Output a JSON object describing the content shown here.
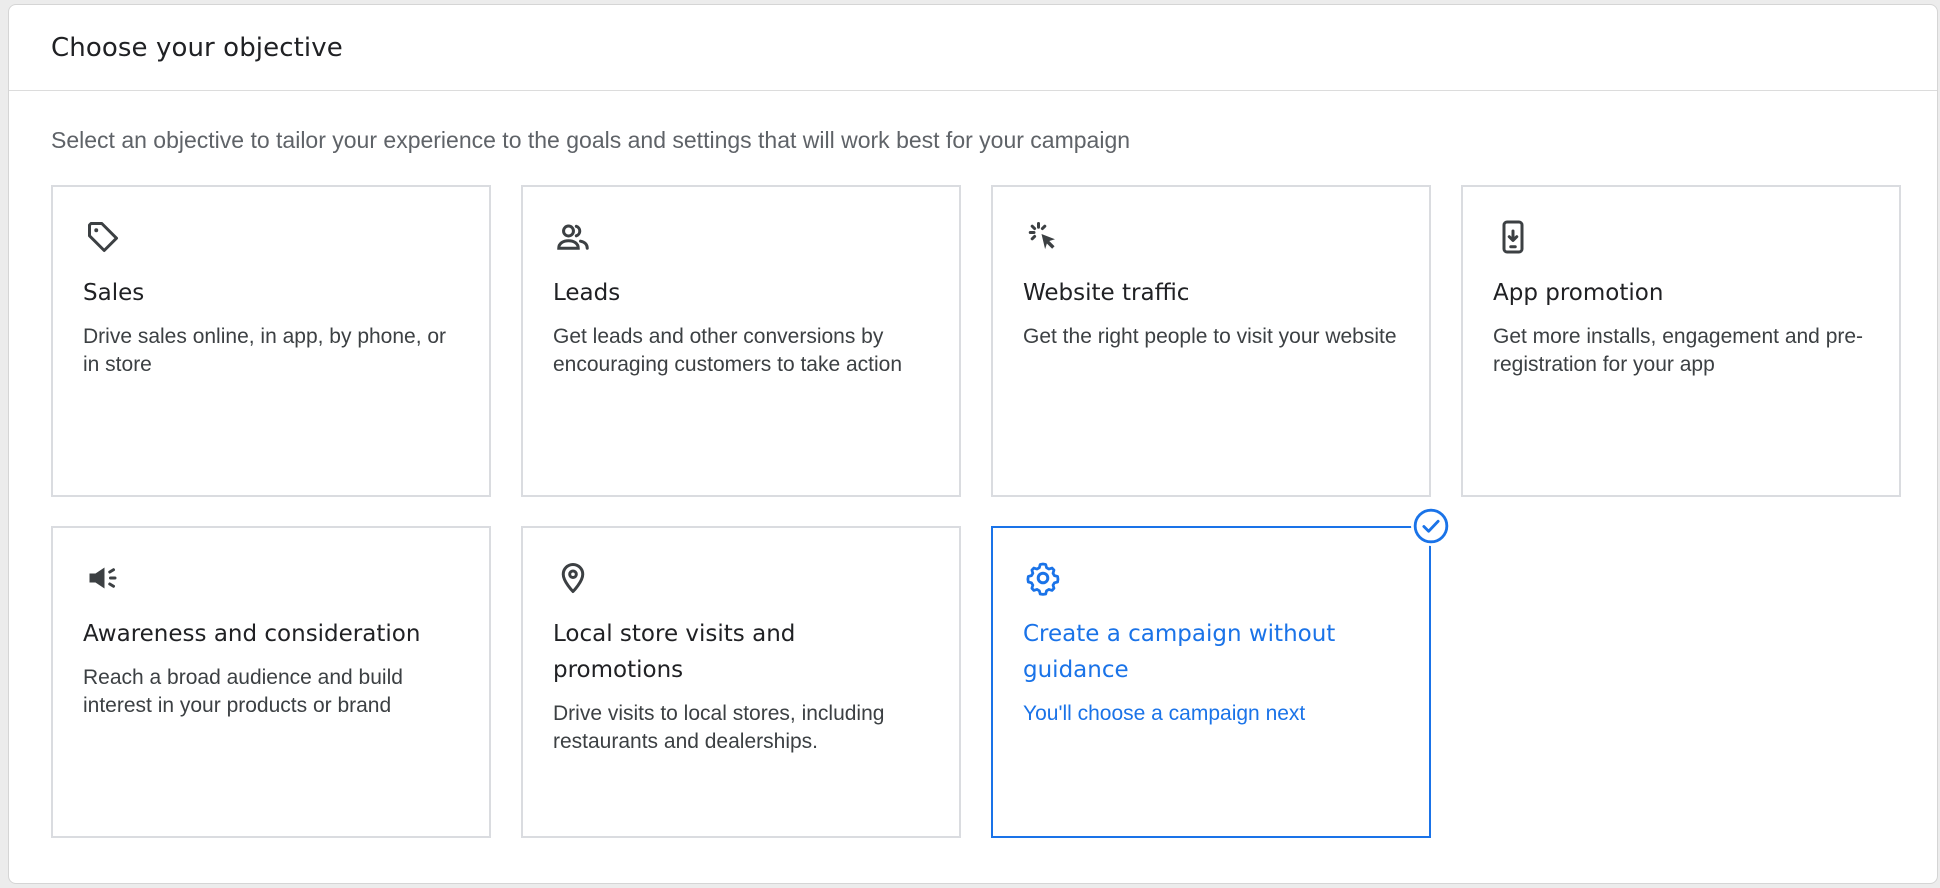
{
  "header": {
    "title": "Choose your objective"
  },
  "subtitle": "Select an objective to tailor your experience to the goals and settings that will work best for your campaign",
  "accent_color": "#1a73e8",
  "cards": [
    {
      "icon": "tag-icon",
      "title": "Sales",
      "description": "Drive sales online, in app, by phone, or in store",
      "selected": false
    },
    {
      "icon": "people-icon",
      "title": "Leads",
      "description": "Get leads and other conversions by encouraging customers to take action",
      "selected": false
    },
    {
      "icon": "cursor-click-icon",
      "title": "Website traffic",
      "description": "Get the right people to visit your website",
      "selected": false
    },
    {
      "icon": "phone-download-icon",
      "title": "App promotion",
      "description": "Get more installs, engagement and pre-registration for your app",
      "selected": false
    },
    {
      "icon": "megaphone-icon",
      "title": "Awareness and consideration",
      "description": "Reach a broad audience and build interest in your products or brand",
      "selected": false
    },
    {
      "icon": "location-pin-icon",
      "title": "Local store visits and promotions",
      "description": "Drive visits to local stores, including restaurants and dealerships.",
      "selected": false
    },
    {
      "icon": "gear-icon",
      "title": "Create a campaign without guidance",
      "description": "You'll choose a campaign next",
      "selected": true
    }
  ],
  "selected_badge_icon": "check-circle-icon"
}
